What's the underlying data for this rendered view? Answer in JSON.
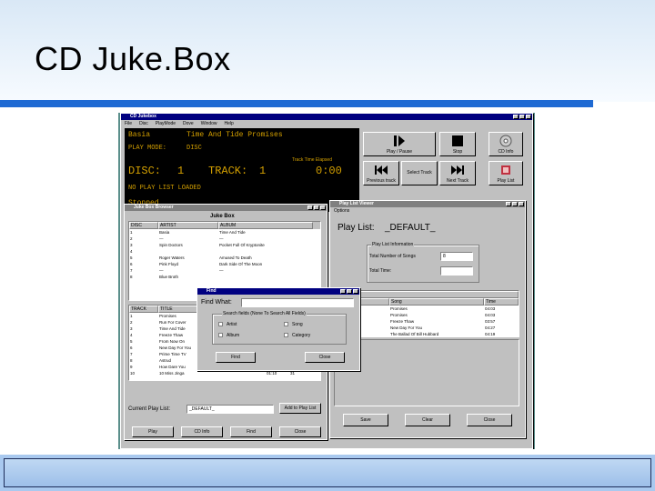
{
  "slide": {
    "title": "CD Juke.Box"
  },
  "main_window": {
    "title": "CD Jukebox",
    "menus": [
      "File",
      "Disc",
      "PlayMode",
      "Dove",
      "Window",
      "Help"
    ],
    "lcd": {
      "artist": "Basia",
      "album": "Time And Tide Promises",
      "play_mode_label": "PLAY MODE:",
      "play_mode_value": "DISC",
      "elapsed_label": "Track Time Elapsed",
      "disc_label": "DISC:",
      "disc_value": "1",
      "track_label": "TRACK:",
      "track_value": "1",
      "time": "0:00",
      "status1": "NO PLAY LIST LOADED",
      "status2": "Stopped"
    },
    "buttons": {
      "play_pause": "Play / Pause",
      "stop": "Stop",
      "cd_info": "CD Info",
      "previous_track": "Previous track",
      "select_track": "Select Track",
      "next_track": "Next Track",
      "play_list": "Play List"
    }
  },
  "browser": {
    "title": "Juke Box Browser",
    "heading": "Juke Box",
    "disc_columns": [
      "DISC",
      "ARTIST",
      "ALBUM"
    ],
    "discs": [
      [
        "1",
        "Basia",
        "Time And Tide"
      ],
      [
        "2",
        "—",
        "—"
      ],
      [
        "3",
        "Spin Doctors",
        "Pocket Full Of Kryptonite"
      ],
      [
        "4",
        "",
        ""
      ],
      [
        "5",
        "Roger Waters",
        "Amused To Death"
      ],
      [
        "6",
        "Pink Floyd",
        "Dark Side Of The Moon"
      ],
      [
        "7",
        "—",
        "—"
      ],
      [
        "8",
        "Blue Broth",
        ""
      ]
    ],
    "track_columns": [
      "TRACK",
      "TITLE"
    ],
    "tracks": [
      [
        "1",
        "Promises",
        "",
        ""
      ],
      [
        "2",
        "Run For Cover",
        "",
        ""
      ],
      [
        "3",
        "Time And Tide",
        "",
        ""
      ],
      [
        "4",
        "Freeze Thaw",
        "",
        ""
      ],
      [
        "5",
        "From Now On",
        "",
        ""
      ],
      [
        "6",
        "New Day For You",
        "",
        ""
      ],
      [
        "7",
        "Prime Time TV",
        "",
        ""
      ],
      [
        "8",
        "Astrud",
        "",
        ""
      ],
      [
        "9",
        "How Dare You",
        "03:24",
        "31"
      ],
      [
        "10",
        "10 Miss Jinga",
        "01:10",
        "31"
      ]
    ],
    "current_playlist_label": "Current Play List:",
    "current_playlist_value": "_DEFAULT_",
    "add_button": "Add to Play List",
    "bottom_buttons": [
      "Play",
      "CD Info",
      "Find",
      "Close"
    ]
  },
  "find": {
    "title": "Find",
    "find_what_label": "Find What:",
    "find_what_value": "",
    "group_label": "Search fields (None To Search All Fields)",
    "checkboxes": [
      "Artist",
      "Song",
      "Album",
      "Category"
    ],
    "find_button": "Find",
    "close_button": "Close"
  },
  "playlist": {
    "title": "Play List Viewer",
    "menu": "Options",
    "heading": "Play List:",
    "name": "_DEFAULT_",
    "info_group": "Play List Information",
    "total_songs_label": "Total Number of Songs",
    "total_songs_value": "8",
    "total_time_label": "Total Time:",
    "total_time_value": "",
    "columns": [
      "",
      "Song",
      "Time"
    ],
    "col_group": "Information",
    "rows": [
      [
        "And Tide",
        "Promises",
        "04:03"
      ],
      [
        "And Tide",
        "Promises",
        "04:03"
      ],
      [
        "And Tide",
        "Freeze Thaw",
        "03:57"
      ],
      [
        "And Tide",
        "New Day For You",
        "04:27"
      ],
      [
        "sed To Death",
        "The Ballad Of Bill Hubbard",
        "04:19"
      ],
      [
        "And Tide",
        "From Now On",
        "03:45"
      ]
    ],
    "buttons": [
      "Save",
      "Clear",
      "Close"
    ]
  }
}
